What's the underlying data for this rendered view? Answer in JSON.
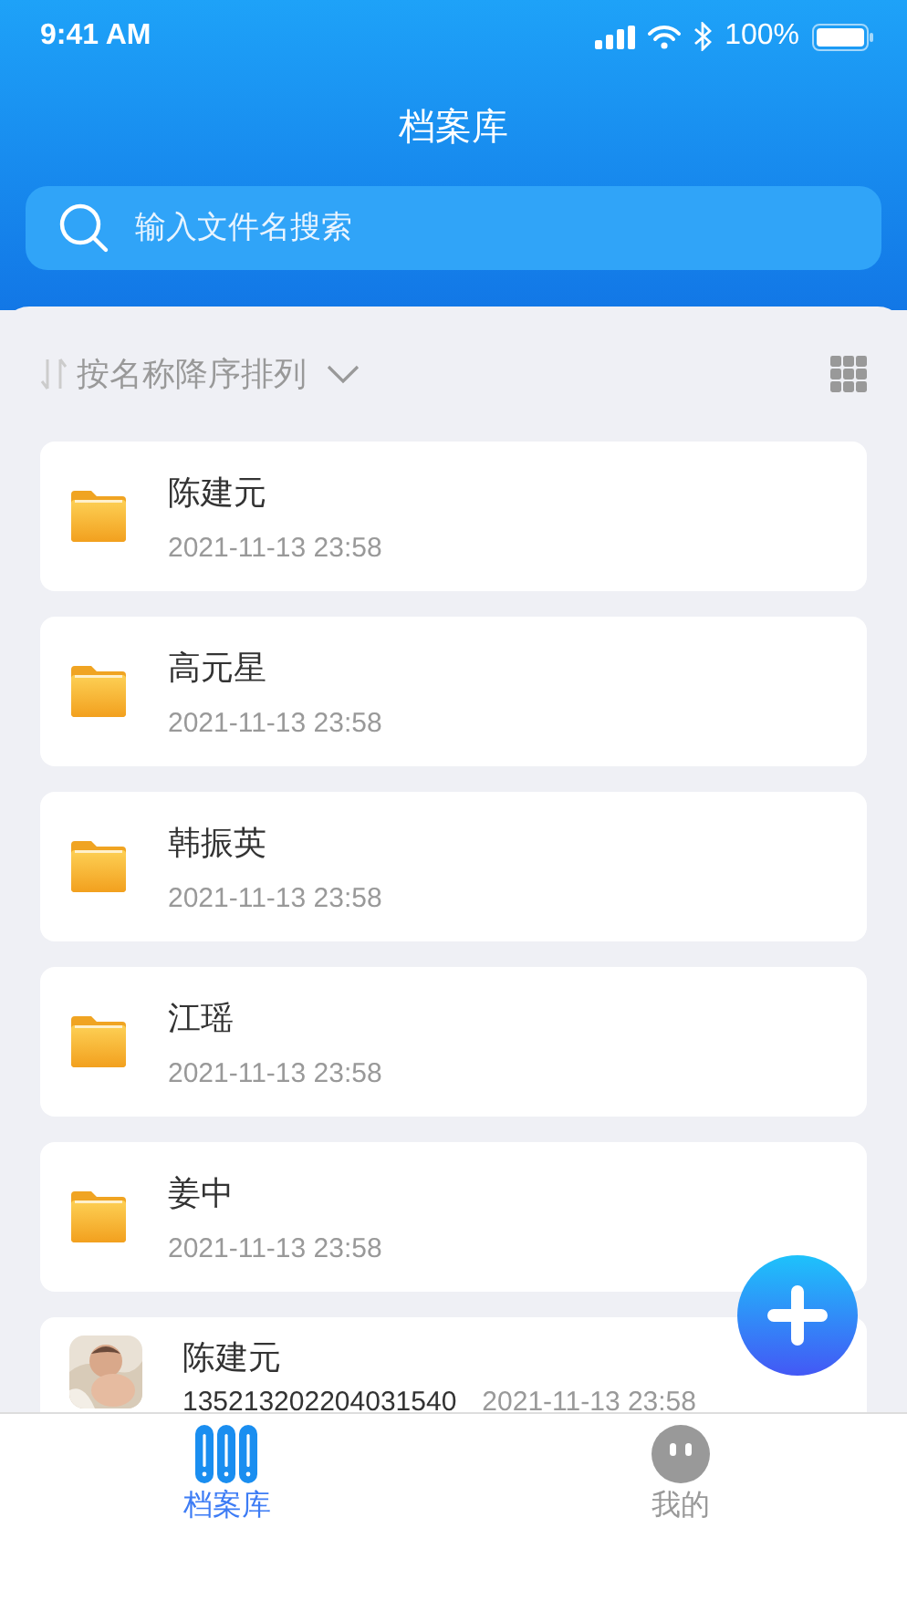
{
  "status_bar": {
    "time": "9:41 AM",
    "battery": "100%"
  },
  "header": {
    "title": "档案库"
  },
  "search": {
    "placeholder": "输入文件名搜索"
  },
  "sort": {
    "label": "按名称降序排列"
  },
  "items": [
    {
      "kind": "folder",
      "name": "陈建元",
      "date": "2021-11-13  23:58"
    },
    {
      "kind": "folder",
      "name": "高元星",
      "date": "2021-11-13  23:58"
    },
    {
      "kind": "folder",
      "name": "韩振英",
      "date": "2021-11-13  23:58"
    },
    {
      "kind": "folder",
      "name": "江瑶",
      "date": "2021-11-13  23:58"
    },
    {
      "kind": "folder",
      "name": "姜中",
      "date": "2021-11-13  23:58"
    },
    {
      "name": "陈建元",
      "code": "135213202204031540",
      "date": "2021-11-13  23:58"
    }
  ],
  "tabs": [
    {
      "label": "档案库",
      "kind": "archive",
      "selected": true
    },
    {
      "label": "我的",
      "kind": "profile",
      "selected": false
    }
  ]
}
